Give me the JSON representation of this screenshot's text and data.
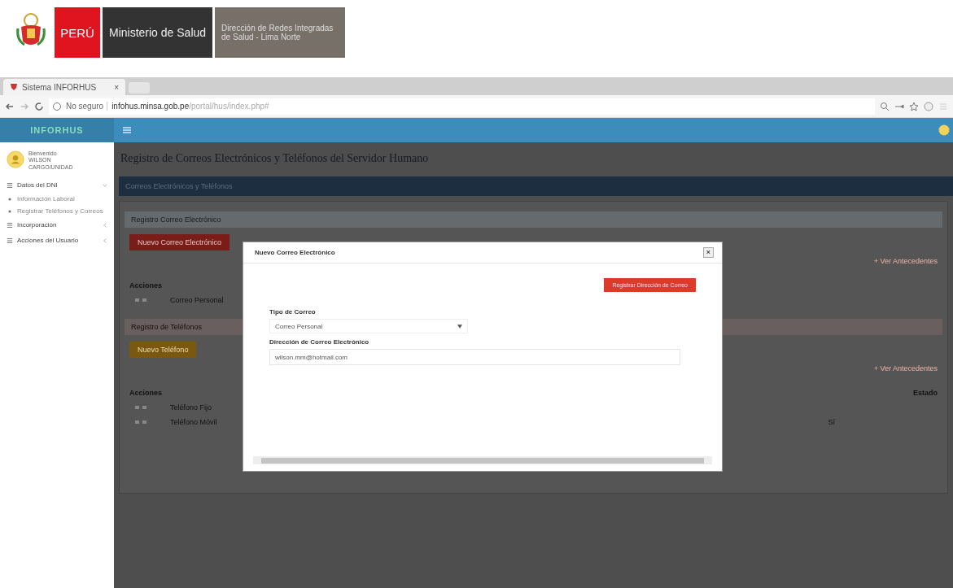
{
  "banner": {
    "country": "PERÚ",
    "ministry": "Ministerio de Salud",
    "office": "Dirección de Redes Integradas de Salud - Lima Norte"
  },
  "browser": {
    "tab_title": "Sistema INFORHUS",
    "tab_close": "×",
    "security": "No seguro",
    "url_host": "infohus.minsa.gob.pe",
    "url_path": "/portal/hus/index.php#"
  },
  "app": {
    "brand": "INFORHUS"
  },
  "sidebar": {
    "welcome": "Bienvenido",
    "user": "WILSON",
    "role": "CARGO/UNIDAD",
    "items": [
      {
        "label": "Datos del DNI",
        "kind": "group",
        "expanded": true
      },
      {
        "label": "Información Laboral",
        "kind": "link"
      },
      {
        "label": "Registrar Teléfonos y Correos",
        "kind": "link"
      },
      {
        "label": "Incorporación",
        "kind": "group",
        "expanded": false
      },
      {
        "label": "Acciones del Usuario",
        "kind": "group",
        "expanded": false
      }
    ]
  },
  "page": {
    "title": "Registro de Correos Electrónicos y Teléfonos del Servidor Humano",
    "tab": "Correos Electrónicos y Teléfonos",
    "panels": [
      {
        "kind": "email",
        "title": "Registro Correo Electrónico",
        "button": "Nuevo Correo Electrónico",
        "link": "+ Ver Antecedentes",
        "columns": [
          "Acciones"
        ],
        "rows": [
          {
            "cells": [
              "Correo Personal"
            ]
          }
        ]
      },
      {
        "kind": "phone",
        "title": "Registro de Teléfonos",
        "button": "Nuevo Teléfono",
        "link": "+ Ver Antecedentes",
        "columns": [
          "Acciones",
          "Estado"
        ],
        "rows": [
          {
            "cells": [
              "Teléfono Fijo",
              ""
            ]
          },
          {
            "cells": [
              "Teléfono Móvil",
              "Sí"
            ]
          }
        ]
      }
    ]
  },
  "modal": {
    "title": "Nuevo Correo Electrónico",
    "close": "×",
    "button": "Registrar Dirección de Correo",
    "fields": [
      {
        "label": "Tipo de Correo",
        "kind": "select",
        "value": "Correo Personal"
      },
      {
        "label": "Dirección de Correo Electrónico",
        "kind": "text",
        "value": "wilson.mm@hotmail.com"
      }
    ]
  }
}
